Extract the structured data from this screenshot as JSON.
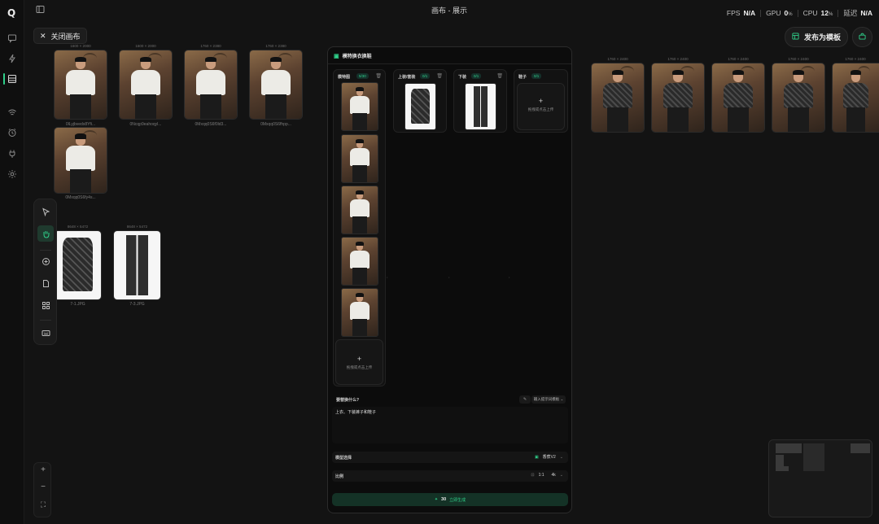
{
  "app": {
    "logo": "Q",
    "title": "画布 - 展示"
  },
  "stats": {
    "fps_label": "FPS",
    "fps_value": "N/A",
    "gpu_label": "GPU",
    "gpu_value": "0",
    "gpu_unit": "%",
    "cpu_label": "CPU",
    "cpu_value": "12",
    "cpu_unit": "%",
    "latency_label": "延迟",
    "latency_value": "N/A"
  },
  "header": {
    "close_canvas": "关闭画布",
    "publish_template": "发布为模板"
  },
  "accent_color": "#2fd08a",
  "left_rail_icons": [
    "chat-icon",
    "bolt-icon",
    "layout-icon",
    "wifi-icon",
    "alarm-icon",
    "plug-icon",
    "gear-icon"
  ],
  "canvas": {
    "model_images": [
      {
        "dim": "1600 × 2000",
        "name": "0lLyjbvedx8Yfi..."
      },
      {
        "dim": "1600 × 2000",
        "name": "0Ncqp9eahoqyl..."
      },
      {
        "dim": "1760 × 2380",
        "name": "0Mxqq0S6f0ld3..."
      },
      {
        "dim": "1760 × 2380",
        "name": "0Mxqq0S6fhpp..."
      },
      {
        "dim": "",
        "name": "0Mxqq0S6fy4s..."
      }
    ],
    "garment_images": [
      {
        "dim": "8648 × 5472",
        "name": "7-1.JPG"
      },
      {
        "dim": "8648 × 5472",
        "name": "7-3.JPG"
      }
    ],
    "results": [
      {
        "dim": "1760 × 2400"
      },
      {
        "dim": "1760 × 2400"
      },
      {
        "dim": "1760 × 2400"
      },
      {
        "dim": "1760 × 2400"
      },
      {
        "dim": "1760 × 2400"
      }
    ]
  },
  "panel": {
    "title": "模特换衣换鞋",
    "model_col": {
      "label": "模特图",
      "count": "5/30"
    },
    "top_col": {
      "label": "上装/套装",
      "count": "0/1"
    },
    "bottom_col": {
      "label": "下装",
      "count": "0/1"
    },
    "shoes_col": {
      "label": "鞋子",
      "count": "0/1"
    },
    "upload_hint": "拖拽或点击上传",
    "prompt_label": "要替换什么?",
    "prompt_edit_chip": "✎",
    "prompt_template_chip": "输入提示词模板 ⌄",
    "prompt_text": "上衣、下装裤子和鞋子",
    "model_select_label": "模型选择",
    "model_select_value": "香蕉V2",
    "ratio_label": "比例",
    "ratio_value": "1:1",
    "resolution_value": "4k",
    "generate_cost": "30",
    "generate_label": "立即生成"
  },
  "zoom": {
    "in": "+",
    "out": "−",
    "fit": "⛶"
  }
}
